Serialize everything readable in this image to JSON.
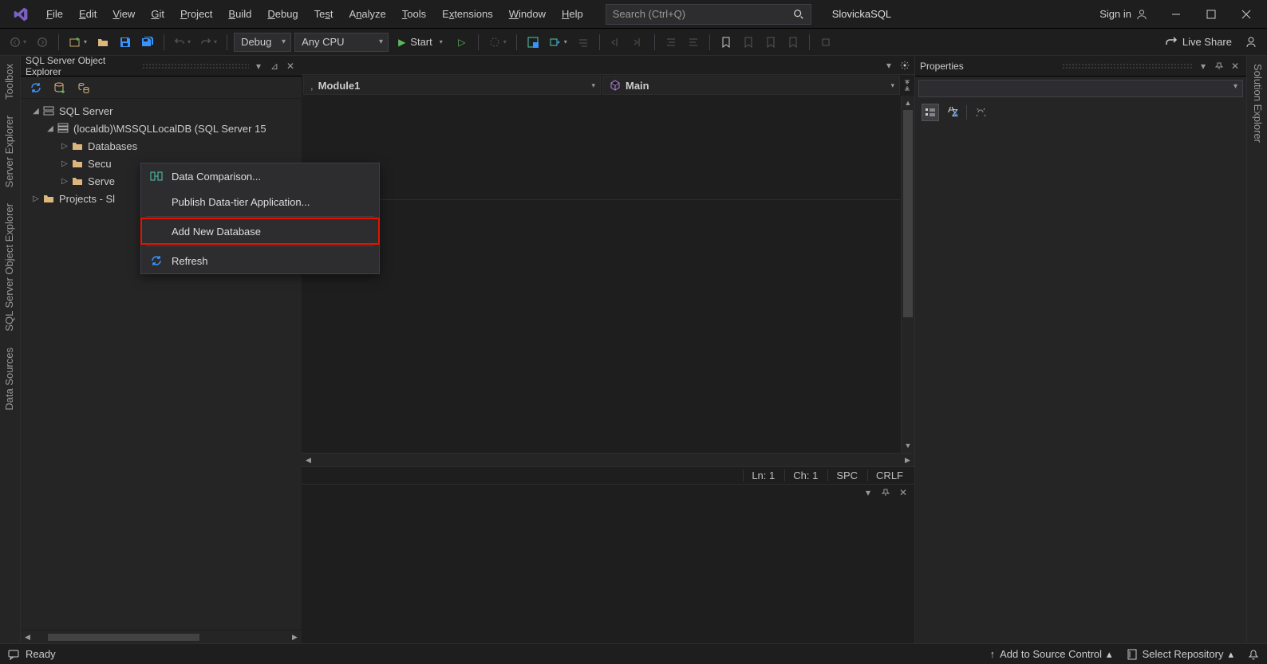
{
  "menu": [
    "File",
    "Edit",
    "View",
    "Git",
    "Project",
    "Build",
    "Debug",
    "Test",
    "Analyze",
    "Tools",
    "Extensions",
    "Window",
    "Help"
  ],
  "search_placeholder": "Search (Ctrl+Q)",
  "project_name": "SlovickaSQL",
  "signin": "Sign in",
  "toolbar": {
    "config": "Debug",
    "platform": "Any CPU",
    "start": "Start",
    "live_share": "Live Share"
  },
  "left_panel": {
    "title": "SQL Server Object Explorer",
    "tree": {
      "root": "SQL Server",
      "instance": "(localdb)\\MSSQLLocalDB (SQL Server 15",
      "databases": "Databases",
      "security": "Secu",
      "server": "Serve",
      "projects": "Projects - Sl"
    }
  },
  "context_menu": {
    "data_comparison": "Data Comparison...",
    "publish": "Publish Data-tier Application...",
    "add_new_db": "Add New Database",
    "refresh": "Refresh"
  },
  "nav": {
    "module": "Module1",
    "main": "Main"
  },
  "editor_status": {
    "ln": "Ln: 1",
    "ch": "Ch: 1",
    "spc": "SPC",
    "crlf": "CRLF"
  },
  "right_panel": {
    "title": "Properties"
  },
  "right_vert_tab": "Solution Explorer",
  "left_vert_tabs": [
    "Toolbox",
    "Server Explorer",
    "SQL Server Object Explorer",
    "Data Sources"
  ],
  "statusbar": {
    "ready": "Ready",
    "source_control": "Add to Source Control",
    "repo": "Select Repository"
  }
}
